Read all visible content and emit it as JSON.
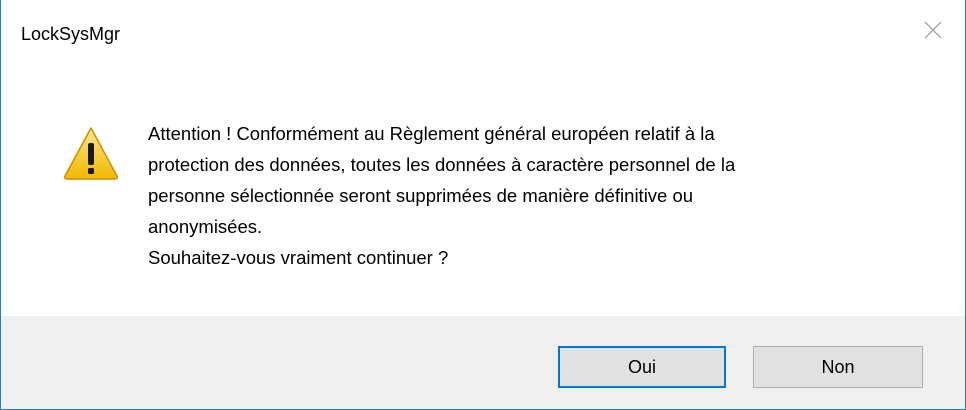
{
  "dialog": {
    "title": "LockSysMgr",
    "close_icon": "close-icon",
    "warning_icon": "warning-icon",
    "message": "Attention ! Conformément au Règlement général européen relatif à la\nprotection des données, toutes les données à caractère personnel de la\npersonne sélectionnée seront supprimées de manière définitive ou\nanonymisées.\nSouhaitez-vous vraiment continuer ?",
    "buttons": {
      "yes_label": "Oui",
      "no_label": "Non"
    }
  },
  "colors": {
    "border": "#1883d7",
    "footer_bg": "#f0f0f0",
    "button_bg": "#e1e1e1",
    "default_button_border": "#0078d7",
    "warning_yellow": "#f5c400"
  }
}
